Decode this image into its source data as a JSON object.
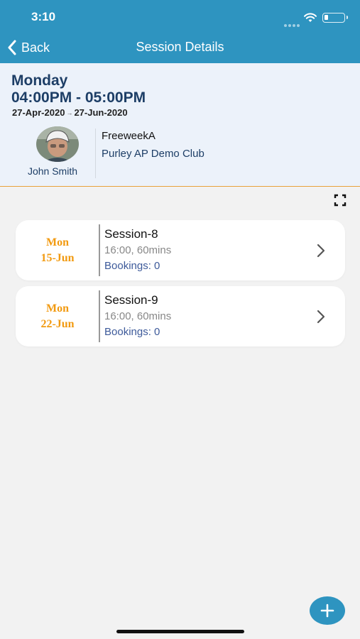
{
  "status_bar": {
    "time": "3:10"
  },
  "nav": {
    "back_label": "Back",
    "title": "Session Details"
  },
  "header": {
    "day": "Monday",
    "time_range": "04:00PM - 05:00PM",
    "start_date": "27-Apr-2020",
    "end_date": "27-Jun-2020",
    "coach_name": "John Smith",
    "session_name": "FreeweekA",
    "club_name": "Purley AP Demo Club"
  },
  "sessions": [
    {
      "weekday": "Mon",
      "date": "15-Jun",
      "title": "Session-8",
      "time": "16:00, 60mins",
      "bookings": "Bookings: 0"
    },
    {
      "weekday": "Mon",
      "date": "22-Jun",
      "title": "Session-9",
      "time": "16:00, 60mins",
      "bookings": "Bookings: 0"
    }
  ],
  "colors": {
    "accent": "#2e94c0",
    "date_orange": "#f29a10",
    "navy": "#1d3e66"
  },
  "icons": [
    "chevron-left-icon",
    "wifi-icon",
    "battery-icon",
    "fullscreen-icon",
    "chevron-right-icon",
    "plus-icon"
  ]
}
